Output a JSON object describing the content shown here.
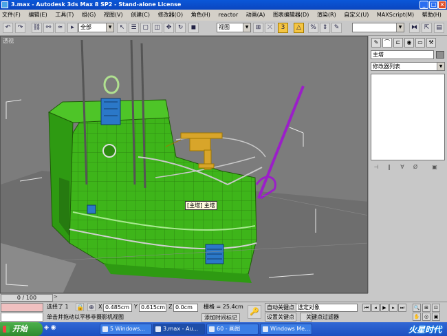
{
  "window": {
    "title": "3.max - Autodesk 3ds Max 8 SP2 - Stand-alone License",
    "minimize": "_",
    "maximize": "□",
    "close": "×"
  },
  "menu": [
    "文件(F)",
    "编辑(E)",
    "工具(T)",
    "组(G)",
    "视图(V)",
    "创建(C)",
    "修改器(O)",
    "角色(H)",
    "reactor",
    "动画(A)",
    "图表编辑器(D)",
    "渲染(R)",
    "自定义(U)",
    "MAXScript(M)",
    "帮助(H)"
  ],
  "toolbar": {
    "selection_filter": "全部",
    "reference_coord": "视图",
    "named_selection": ""
  },
  "viewport": {
    "label": "透视",
    "object_tag": "[主塔] 主塔"
  },
  "command_panel": {
    "object_name": "主塔",
    "modifier_list": "修改器列表",
    "object_color": "#8e8e8e"
  },
  "timeline": {
    "frame": "0 / 100"
  },
  "status": {
    "selection": "选择了 1",
    "prompt": "单击并拖动以平移非摄影机视图",
    "x_label": "X",
    "x_value": "0.485cm",
    "y_label": "Y",
    "y_value": "0.615cm",
    "z_label": "Z",
    "z_value": "0.0cm",
    "grid": "栅格 = 25.4cm",
    "add_time_tag": "添加时间标记",
    "auto_key": "自动关键点",
    "set_key": "设置关键点",
    "key_filter_mode": "选定对象",
    "key_filters": "关键点过滤器"
  },
  "taskbar": {
    "start": "开始",
    "tasks": [
      "5 Windows...",
      "3.max - Au...",
      "60 - 画图",
      "Windows Me..."
    ],
    "watermark": "火星时代"
  },
  "colors": {
    "title_blue": "#0a4fd0",
    "model_green": "#3eb51a",
    "selection_purple": "#9b1fc8",
    "gun_gold": "#d8a52a",
    "accent_yellow": "#f5c542"
  }
}
